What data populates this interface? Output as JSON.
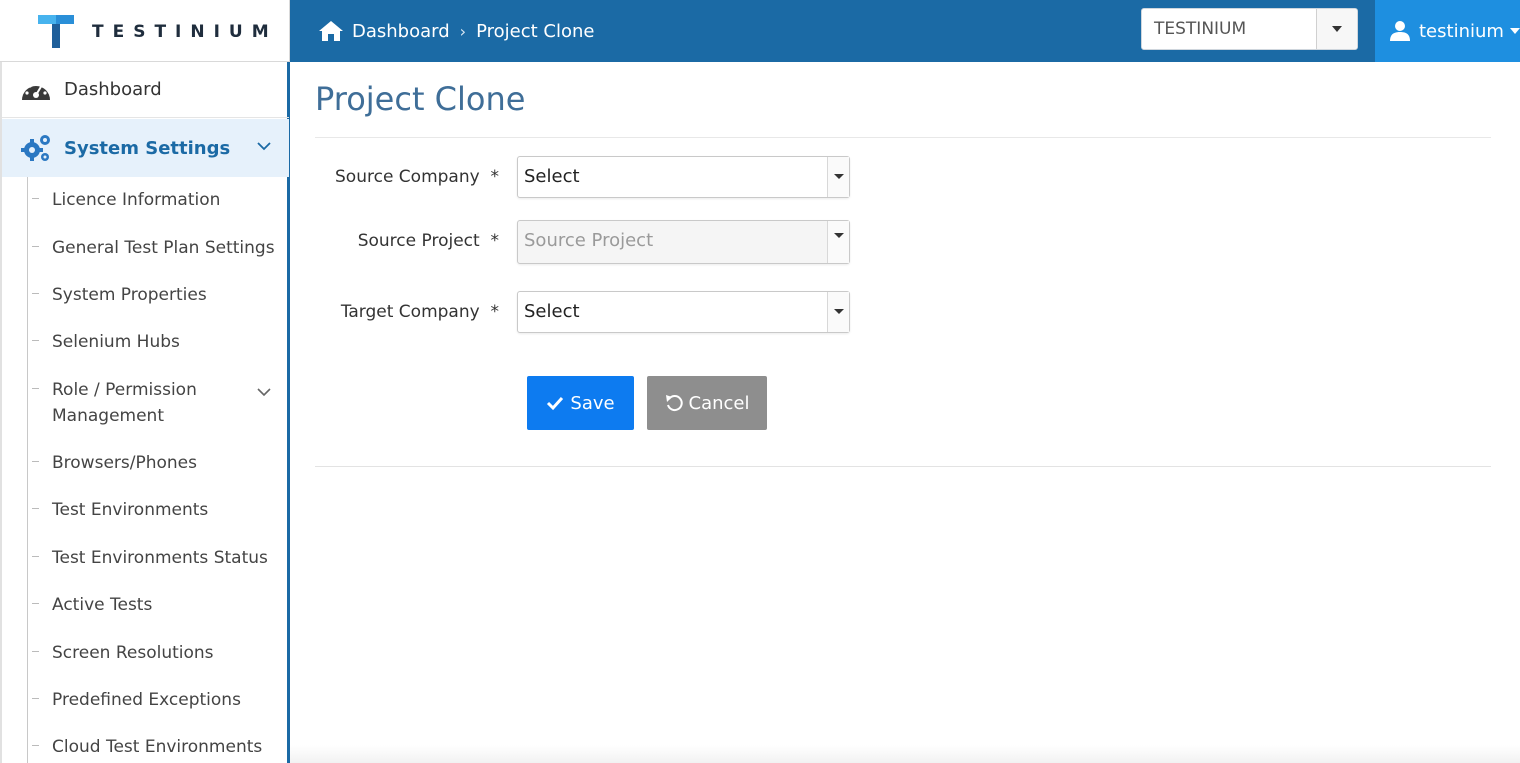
{
  "header": {
    "logo_text": "TESTINIUM",
    "breadcrumb": {
      "home": "Dashboard",
      "current": "Project Clone"
    },
    "company_select": {
      "value": "TESTINIUM"
    },
    "user": {
      "name": "testinium"
    }
  },
  "sidebar": {
    "dashboard": "Dashboard",
    "section": "System Settings",
    "items": [
      {
        "label": "Licence Information"
      },
      {
        "label": "General Test Plan Settings"
      },
      {
        "label": "System Properties"
      },
      {
        "label": "Selenium Hubs"
      },
      {
        "label": "Role / Permission Management"
      },
      {
        "label": "Browsers/Phones"
      },
      {
        "label": "Test Environments"
      },
      {
        "label": "Test Environments Status"
      },
      {
        "label": "Active Tests"
      },
      {
        "label": "Screen Resolutions"
      },
      {
        "label": "Predefined Exceptions"
      },
      {
        "label": "Cloud Test Environments"
      }
    ]
  },
  "page": {
    "title": "Project Clone",
    "form": {
      "source_company": {
        "label": "Source Company",
        "required": "*",
        "value": "Select"
      },
      "source_project": {
        "label": "Source Project",
        "required": "*",
        "placeholder": "Source Project"
      },
      "target_company": {
        "label": "Target Company",
        "required": "*",
        "value": "Select"
      }
    },
    "buttons": {
      "save": "Save",
      "cancel": "Cancel"
    }
  },
  "colors": {
    "header_blue": "#1b6aa5",
    "user_blue": "#1e8fe0",
    "save_blue": "#0d7bf0",
    "cancel_gray": "#8e8e8e",
    "title_blue": "#3f6e98"
  }
}
